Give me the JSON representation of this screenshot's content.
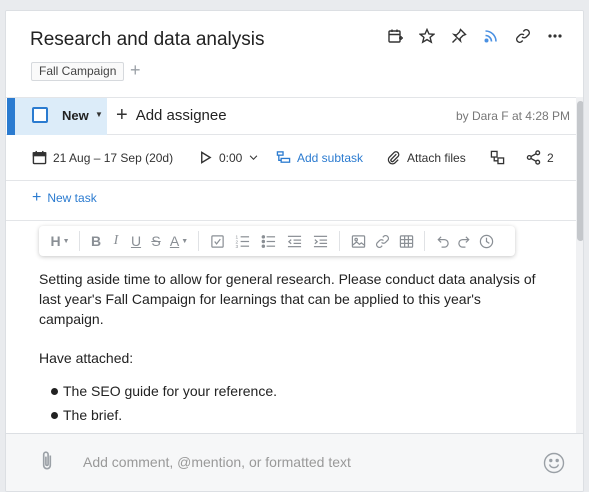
{
  "header": {
    "title": "Research and data analysis",
    "tag": "Fall Campaign",
    "tag_add": "+",
    "icons": [
      "add-to-calendar-icon",
      "star-icon",
      "pin-icon",
      "rss-icon",
      "link-icon",
      "more-icon"
    ]
  },
  "status": {
    "label": "New",
    "assignee_label": "Add assignee",
    "byline": "by Dara F at 4:28 PM"
  },
  "meta": {
    "dates": "21 Aug – 17 Sep (20d)",
    "timer": "0:00",
    "add_subtask": "Add subtask",
    "attach_files": "Attach files",
    "share_count": "2"
  },
  "new_task_label": "New task",
  "toolbar": {
    "heading": "H",
    "bold": "B",
    "italic": "I",
    "underline": "U",
    "strike": "S",
    "font_color": "A"
  },
  "body": {
    "paragraph1": "Setting aside time to allow for general research. Please conduct data analysis of last year's Fall Campaign for learnings that can be applied to this year's campaign.",
    "paragraph2": "Have attached:",
    "bullets": [
      "The SEO guide for your reference.",
      "The brief."
    ]
  },
  "comment": {
    "placeholder": "Add comment, @mention, or formatted text"
  },
  "colors": {
    "accent": "#2b7bd0",
    "status_bg": "#dcecf9",
    "rss": "#4a90e2"
  }
}
